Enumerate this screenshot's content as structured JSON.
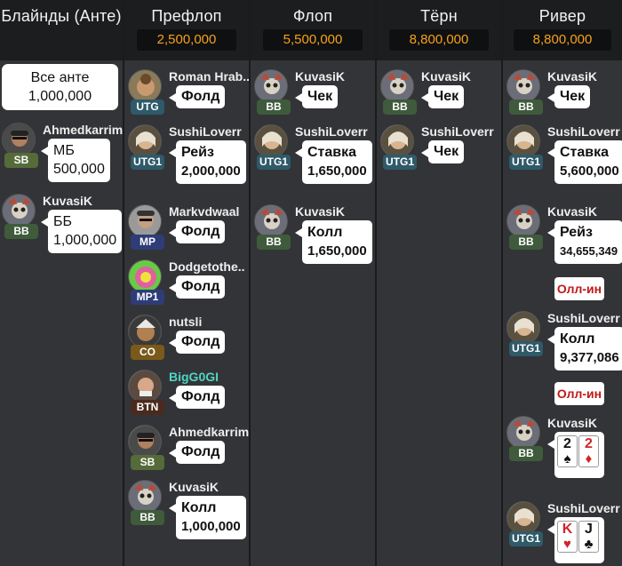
{
  "headers": [
    {
      "title": "Блайнды (Анте)",
      "pot": ""
    },
    {
      "title": "Префлоп",
      "pot": "2,500,000"
    },
    {
      "title": "Флоп",
      "pot": "5,500,000"
    },
    {
      "title": "Тёрн",
      "pot": "8,800,000"
    },
    {
      "title": "Ривер",
      "pot": "8,800,000"
    }
  ],
  "colors": {
    "header_bg": "#1c1d1f",
    "column_bg": "#333437",
    "pot_text": "#f6a01e",
    "allin_text": "#c01818",
    "bigg0gi_name": "#4fd6c4"
  },
  "blinds": {
    "ante_label": "Все анте",
    "ante_amount": "1,000,000",
    "players": [
      {
        "name": "Ahmedkarrim",
        "position": "SB",
        "action": "МБ",
        "amount": "500,000"
      },
      {
        "name": "KuvasiK",
        "position": "BB",
        "action": "ББ",
        "amount": "1,000,000"
      }
    ]
  },
  "preflop": [
    {
      "name": "Roman Hrab..",
      "position": "UTG",
      "action": "Фолд"
    },
    {
      "name": "SushiLoverr",
      "position": "UTG1",
      "action": "Рейз",
      "amount": "2,000,000"
    },
    {
      "name": "Markvdwaal",
      "position": "MP",
      "action": "Фолд"
    },
    {
      "name": "Dodgetothe..",
      "position": "MP1",
      "action": "Фолд"
    },
    {
      "name": "nutsli",
      "position": "CO",
      "action": "Фолд"
    },
    {
      "name": "BigG0GI",
      "position": "BTN",
      "action": "Фолд"
    },
    {
      "name": "Ahmedkarrim",
      "position": "SB",
      "action": "Фолд"
    },
    {
      "name": "KuvasiK",
      "position": "BB",
      "action": "Колл",
      "amount": "1,000,000"
    }
  ],
  "flop": [
    {
      "name": "KuvasiK",
      "position": "BB",
      "action": "Чек"
    },
    {
      "name": "SushiLoverr",
      "position": "UTG1",
      "action": "Ставка",
      "amount": "1,650,000"
    },
    {
      "name": "KuvasiK",
      "position": "BB",
      "action": "Колл",
      "amount": "1,650,000"
    }
  ],
  "turn": [
    {
      "name": "KuvasiK",
      "position": "BB",
      "action": "Чек"
    },
    {
      "name": "SushiLoverr",
      "position": "UTG1",
      "action": "Чек"
    }
  ],
  "river": [
    {
      "name": "KuvasiK",
      "position": "BB",
      "action": "Чек"
    },
    {
      "name": "SushiLoverr",
      "position": "UTG1",
      "action": "Ставка",
      "amount": "5,600,000"
    },
    {
      "name": "KuvasiK",
      "position": "BB",
      "action": "Рейз",
      "amount": "34,655,349",
      "allin": "Олл-ин"
    },
    {
      "name": "SushiLoverr",
      "position": "UTG1",
      "action": "Колл",
      "amount": "9,377,086",
      "allin": "Олл-ин"
    },
    {
      "name": "KuvasiK",
      "position": "BB",
      "cards": [
        {
          "rank": "2",
          "suit": "♠"
        },
        {
          "rank": "2",
          "suit": "♦"
        }
      ]
    },
    {
      "name": "SushiLoverr",
      "position": "UTG1",
      "cards": [
        {
          "rank": "K",
          "suit": "♥"
        },
        {
          "rank": "J",
          "suit": "♣"
        }
      ]
    }
  ]
}
